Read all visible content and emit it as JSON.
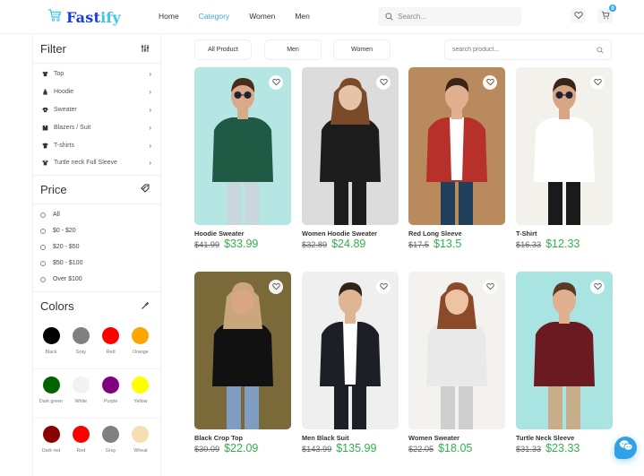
{
  "brand": {
    "name_main": "Fast",
    "name_accent": "ify",
    "logo_icon": "cart-icon",
    "colors": {
      "primary": "#1a3de0",
      "accent": "#3cc4ea"
    }
  },
  "nav": {
    "items": [
      {
        "label": "Home",
        "active": false
      },
      {
        "label": "Category",
        "active": true
      },
      {
        "label": "Women",
        "active": false
      },
      {
        "label": "Men",
        "active": false
      }
    ]
  },
  "header_search": {
    "placeholder": "Search...",
    "value": ""
  },
  "header_actions": {
    "wishlist_icon": "heart-icon",
    "cart_icon": "cart-icon",
    "cart_count": "0"
  },
  "sidebar": {
    "filter": {
      "title": "Filter",
      "icon": "sliders-icon",
      "categories": [
        {
          "label": "Top",
          "icon": "shirt-icon"
        },
        {
          "label": "Hoodie",
          "icon": "hoodie-icon"
        },
        {
          "label": "Sweater",
          "icon": "sweater-icon"
        },
        {
          "label": "Blazers / Suit",
          "icon": "suit-icon"
        },
        {
          "label": "T-shirts",
          "icon": "tshirt-icon"
        },
        {
          "label": "Turtle neck Full Sleeve",
          "icon": "turtleneck-icon"
        }
      ]
    },
    "price": {
      "title": "Price",
      "icon": "price-tags-icon",
      "options": [
        "All",
        "$0 - $20",
        "$20 - $50",
        "$50 - $100",
        "Over $100"
      ]
    },
    "colors": {
      "title": "Colors",
      "icon": "eyedropper-icon",
      "rows": [
        [
          {
            "label": "Black",
            "hex": "#000000"
          },
          {
            "label": "Gray",
            "hex": "#808080"
          },
          {
            "label": "Red",
            "hex": "#ff0000"
          },
          {
            "label": "Orange",
            "hex": "#ffa500"
          }
        ],
        [
          {
            "label": "Dark green",
            "hex": "#006400"
          },
          {
            "label": "White",
            "hex": "#f2f2f2"
          },
          {
            "label": "Purple",
            "hex": "#800080"
          },
          {
            "label": "Yellow",
            "hex": "#ffff00"
          }
        ],
        [
          {
            "label": "Dark red",
            "hex": "#8b0000"
          },
          {
            "label": "Red",
            "hex": "#ff0000"
          },
          {
            "label": "Gray",
            "hex": "#808080"
          },
          {
            "label": "Wheat",
            "hex": "#f5deb3"
          }
        ]
      ]
    }
  },
  "main": {
    "filter_buttons": [
      "All Product",
      "Men",
      "Women"
    ],
    "product_search": {
      "placeholder": "search product...",
      "value": ""
    },
    "products": [
      {
        "name": "Hoodie Sweater",
        "old_price": "$41.99",
        "price": "$33.99",
        "bg": "#b6e6e4"
      },
      {
        "name": "Women Hoodie Sweater",
        "old_price": "$32.89",
        "price": "$24.89",
        "bg": "#dcdcdc"
      },
      {
        "name": "Red Long Sleeve",
        "old_price": "$17.5",
        "price": "$13.5",
        "bg": "#b98a5e"
      },
      {
        "name": "T-Shirt",
        "old_price": "$16.33",
        "price": "$12.33",
        "bg": "#f3f1ec"
      },
      {
        "name": "Black Crop Top",
        "old_price": "$30.09",
        "price": "$22.09",
        "bg": "#7a6a3a"
      },
      {
        "name": "Men Black Suit",
        "old_price": "$143.99",
        "price": "$135.99",
        "bg": "#efefef"
      },
      {
        "name": "Women Sweater",
        "old_price": "$22.05",
        "price": "$18.05",
        "bg": "#f4f2ef"
      },
      {
        "name": "Turtle Neck Sleeve",
        "old_price": "$31.33",
        "price": "$23.33",
        "bg": "#a9e4e2"
      }
    ]
  },
  "chat": {
    "icon": "chat-bubbles-icon"
  }
}
